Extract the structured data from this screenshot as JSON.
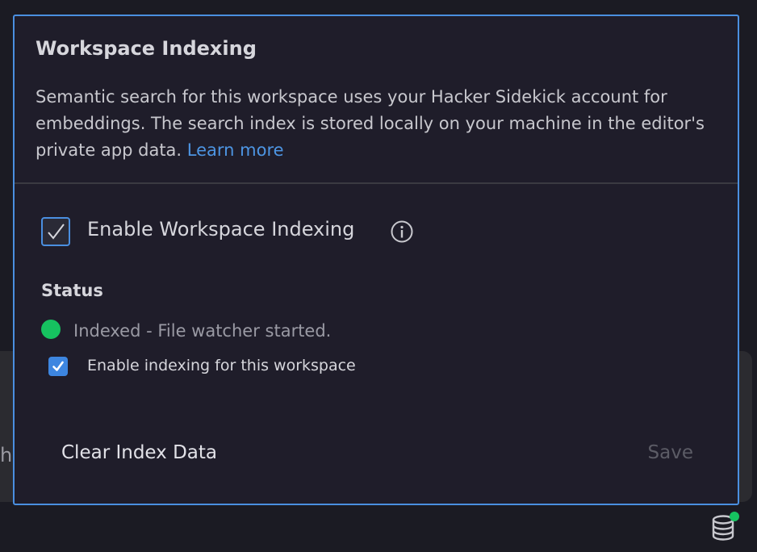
{
  "dialog": {
    "title": "Workspace Indexing",
    "description": "Semantic search for this workspace uses your Hacker Sidekick account for embeddings. The search index is stored locally on your machine in the editor's private app data.",
    "learn_more": "Learn more",
    "enable_label": "Enable Workspace Indexing",
    "enable_checked": true,
    "status_heading": "Status",
    "status_text": "Indexed - File watcher started.",
    "status_color": "#16c260",
    "workspace_enable_label": "Enable indexing for this workspace",
    "workspace_enable_checked": true,
    "clear_button": "Clear Index Data",
    "save_button": "Save"
  },
  "background": {
    "partial_text": "h"
  },
  "icons": {
    "info": "info-icon",
    "database": "database-icon",
    "check": "checkmark-icon"
  },
  "colors": {
    "accent": "#4a8fe0",
    "link": "#4d95e3",
    "status_ok": "#16c260",
    "dialog_bg": "#1f1d2a"
  }
}
